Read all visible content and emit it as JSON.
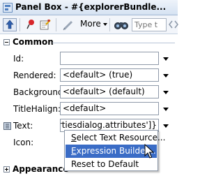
{
  "titlebar": {
    "title": "Panel Box - #{explorerBundle..."
  },
  "toolbar": {
    "more_label": "More",
    "find_placeholder": "Type t"
  },
  "sections": {
    "common": {
      "label": "Common"
    },
    "appearance": {
      "label": "Appearance"
    }
  },
  "properties": {
    "id": {
      "label": "Id:",
      "value": ""
    },
    "rendered": {
      "label": "Rendered:",
      "value": "<default> (true)"
    },
    "background": {
      "label": "Background:",
      "value": "<default> (default)"
    },
    "titlehalign": {
      "label": "TitleHalign:",
      "value": "<default>"
    },
    "text": {
      "label": "Text:",
      "value": "ropertiesdialog.attributes']}"
    },
    "icon": {
      "label": "Icon:",
      "value": ""
    }
  },
  "context_menu": {
    "items": [
      {
        "pre": "",
        "mnemonic": "S",
        "post": "elect Text Resource..."
      },
      {
        "pre": "",
        "mnemonic": "E",
        "post": "xpression Builder..."
      },
      {
        "pre": "Reset to Default",
        "mnemonic": "",
        "post": ""
      }
    ],
    "selected_index": 1
  },
  "colors": {
    "selection": "#3a6cc6",
    "titlebar": "#d5e2f2",
    "toolbar": "#f2f5fa"
  },
  "icons": {
    "title": "panel-box-icon",
    "toolbar": [
      "up-arrow-icon",
      "pin-icon",
      "edit-properties-icon",
      "pencil-icon",
      "binoculars-icon",
      "left-arrow-icon",
      "right-arrow-icon"
    ]
  }
}
